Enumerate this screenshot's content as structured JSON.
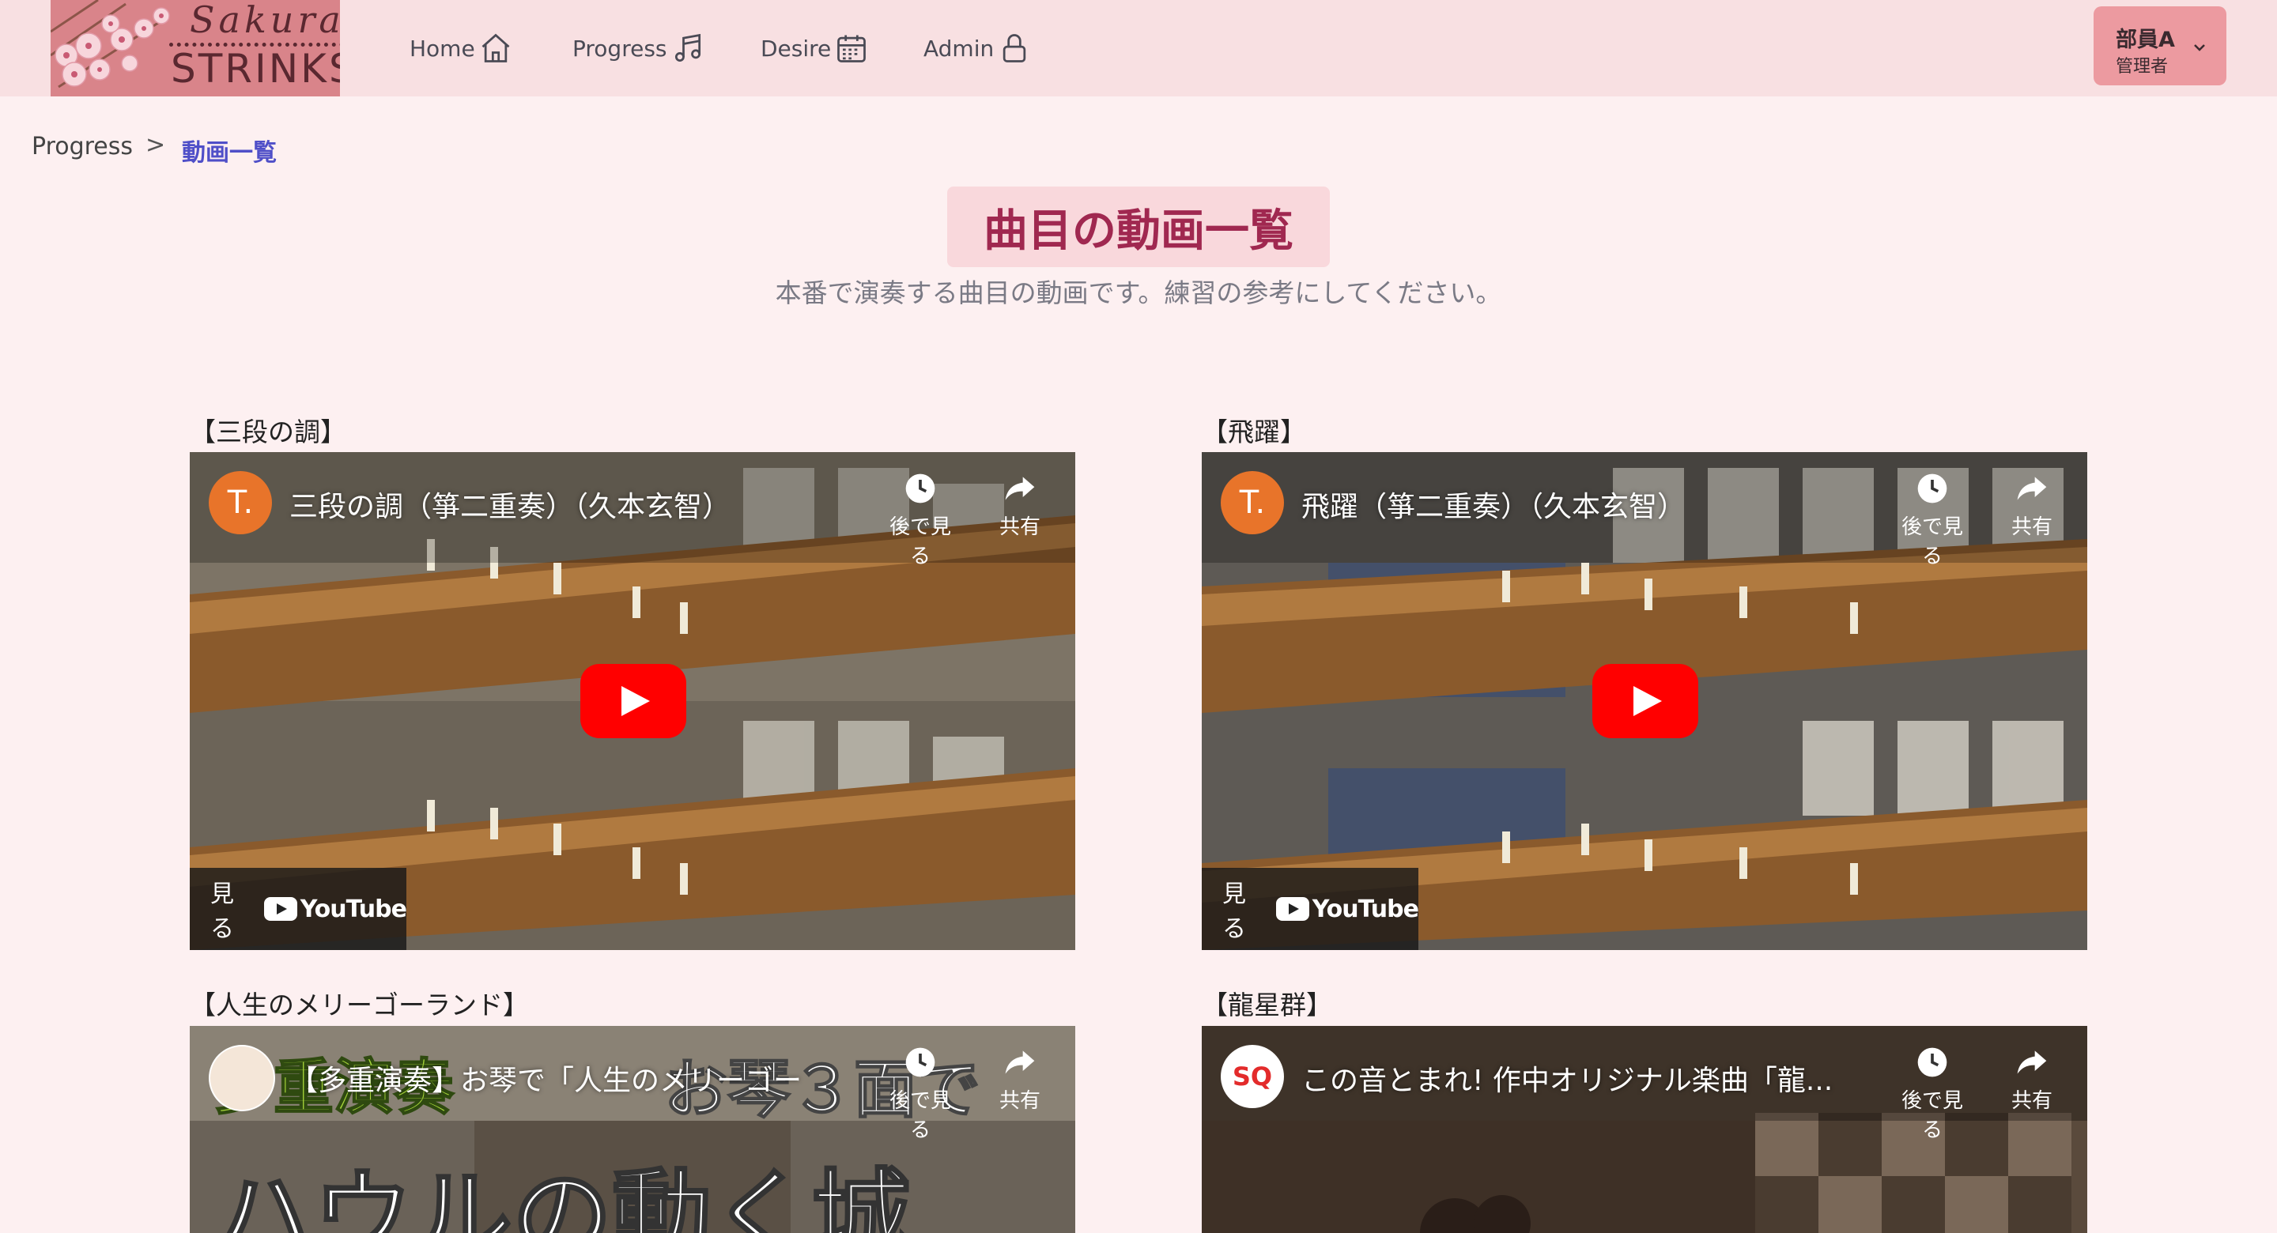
{
  "navbar": {
    "logo": {
      "line1": "Sakura",
      "line2": "STRINKS"
    },
    "items": [
      {
        "label": "Home",
        "icon": "home-icon"
      },
      {
        "label": "Progress",
        "icon": "music-note-icon"
      },
      {
        "label": "Desire",
        "icon": "calendar-icon"
      },
      {
        "label": "Admin",
        "icon": "lock-icon"
      }
    ],
    "user": {
      "name": "部員A",
      "role": "管理者"
    }
  },
  "breadcrumb": {
    "parent": "Progress",
    "separator": ">",
    "current": "動画一覧"
  },
  "page": {
    "title": "曲目の動画一覧",
    "subtitle": "本番で演奏する曲目の動画です。練習の参考にしてください。"
  },
  "videos": [
    {
      "label": "【三段の調】",
      "channel_initial": "T.",
      "title": "三段の調（箏二重奏）（久本玄智）",
      "watch_later": "後で見る",
      "share": "共有",
      "watch_on": "見る",
      "platform": "YouTube"
    },
    {
      "label": "【飛躍】",
      "channel_initial": "T.",
      "title": "飛躍（箏二重奏）（久本玄智）",
      "watch_later": "後で見る",
      "share": "共有",
      "watch_on": "見る",
      "platform": "YouTube"
    },
    {
      "label": "【人生のメリーゴーランド】",
      "channel_initial": "",
      "title": "【多重演奏】お琴で「人生のメリーゴー",
      "thumb_text_1": "多重演奏",
      "thumb_text_2": "お琴３面で",
      "thumb_text_3": "ハウルの動く城",
      "watch_later": "後で見る",
      "share": "共有"
    },
    {
      "label": "【龍星群】",
      "channel_initial": "SQ",
      "title": "この音とまれ! 作中オリジナル楽曲「龍...",
      "watch_later": "後で見る",
      "share": "共有"
    }
  ],
  "colors": {
    "background": "#fdf0f1",
    "navbar": "#f8e0e2",
    "accent_title": "#a02850",
    "breadcrumb_link": "#4f4fc8",
    "user_box": "#ec9aa0",
    "youtube_red": "#ff0000"
  }
}
